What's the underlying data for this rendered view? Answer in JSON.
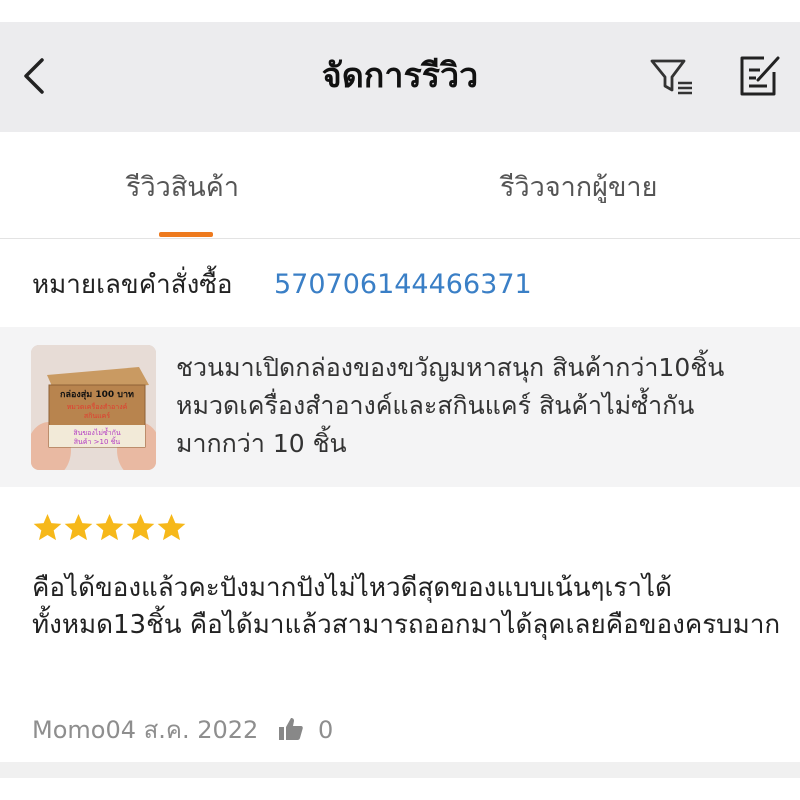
{
  "header": {
    "title": "จัดการรีวิว",
    "back_icon": "chevron-left-icon",
    "filter_icon": "filter-icon",
    "edit_icon": "edit-icon"
  },
  "tabs": [
    {
      "label": "รีวิวสินค้า",
      "active": true
    },
    {
      "label": "รีวิวจากผู้ขาย",
      "active": false
    }
  ],
  "order": {
    "label": "หมายเลขคำสั่งซื้อ",
    "number": "570706144466371"
  },
  "product": {
    "title": "ชวนมาเปิดกล่องของขวัญมหาสนุก สินค้ากว่า10ชิ้น หมวดเครื่องสำอางค์และสกินแคร์ สินค้าไม่ซ้ำกัน มากกว่า 10 ชิ้น",
    "thumb_text_1": "กล่องสุ่ม 100 บาท",
    "thumb_text_2": "หมวดเครื่องสำอางค์",
    "thumb_text_3": "สกินแคร์",
    "thumb_text_4": "สินของไม่ซ้ำกัน",
    "thumb_text_5": "สินค้า >10 ชิ้น"
  },
  "review": {
    "rating": 5,
    "rating_max": 5,
    "text": "คือได้ของแล้วคะปังมากปังไม่ไหวดีสุดของแบบเน้นๆเราได้ทั้งหมด13ชิ้น คือได้มาแล้วสามารถออกมาได้ลุคเลยคือของครบมาก",
    "meta": "Momo04 ส.ค. 2022",
    "like_count": "0",
    "like_icon": "thumbs-up-icon"
  },
  "colors": {
    "accent": "#ee7a1e",
    "link": "#3a7fc6",
    "star": "#f6b81a",
    "header_bg": "#ececee"
  }
}
